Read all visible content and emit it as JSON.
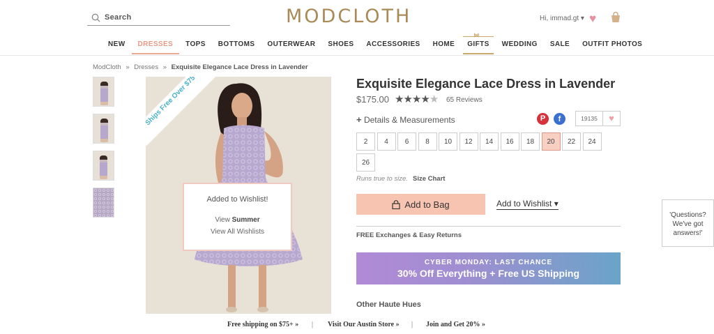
{
  "header": {
    "search_label": "Search",
    "logo": "MODCLOTH",
    "user_greeting": "Hi, immad.gt"
  },
  "nav": {
    "items": [
      "NEW",
      "DRESSES",
      "TOPS",
      "BOTTOMS",
      "OUTERWEAR",
      "SHOES",
      "ACCESSORIES",
      "HOME",
      "GIFTS",
      "WEDDING",
      "SALE",
      "OUTFIT PHOTOS"
    ],
    "active": "DRESSES"
  },
  "breadcrumb": {
    "items": [
      "ModCloth",
      "Dresses",
      "Exquisite Elegance Lace Dress in Lavender"
    ],
    "separator": "»"
  },
  "image": {
    "ribbon_text": "Ships Free Over $75"
  },
  "wishlist_popup": {
    "title": "Added to Wishlist!",
    "view_prefix": "View",
    "view_name": "Summer",
    "view_all": "View All Wishlists"
  },
  "product": {
    "title": "Exquisite Elegance Lace Dress in Lavender",
    "price": "$175.00",
    "rating": 4,
    "reviews": "65 Reviews",
    "details_label": "Details & Measurements",
    "wishlist_count": "19135",
    "sizes": [
      "2",
      "4",
      "6",
      "8",
      "10",
      "12",
      "14",
      "16",
      "18",
      "20",
      "22",
      "24",
      "26"
    ],
    "selected_size": "20",
    "fit_note": "Runs true to size.",
    "size_chart": "Size Chart",
    "add_to_bag": "Add to Bag",
    "add_to_wishlist": "Add to Wishlist",
    "free_exchanges": "FREE Exchanges & Easy Returns",
    "other_hues": "Other Haute Hues"
  },
  "promo": {
    "line1": "CYBER MONDAY: LAST CHANCE",
    "line2": "30% Off Everything + Free US Shipping"
  },
  "questions_widget": {
    "text": "'Questions? We've got answers!'"
  },
  "bottom_bar": {
    "items": [
      "Free shipping on $75+ »",
      "Visit Our Austin Store »",
      "Join and Get 20% »"
    ],
    "separator": "|"
  },
  "colors": {
    "accent": "#e59a86",
    "logo": "#a98a56",
    "add_to_bag_bg": "#f8c4b2"
  }
}
